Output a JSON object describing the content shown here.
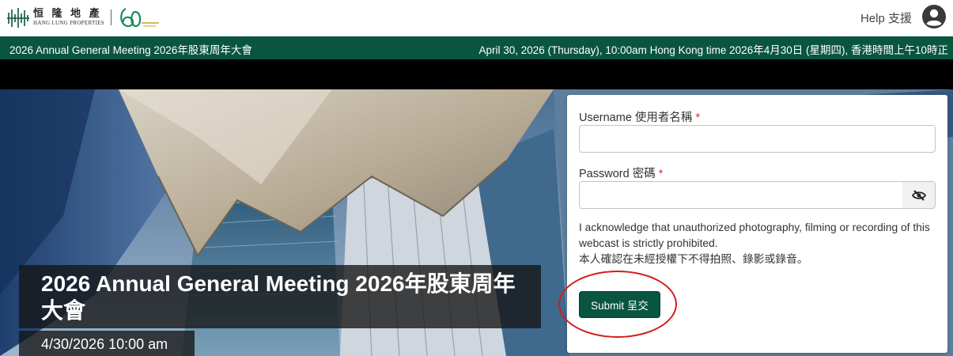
{
  "header": {
    "logo_cn": "恒 隆 地 產",
    "logo_en": "HANG LUNG PROPERTIES",
    "help_label": "Help 支援"
  },
  "banner": {
    "event_name": "2026 Annual General Meeting 2026年股東周年大會",
    "event_datetime": "April 30, 2026 (Thursday), 10:00am Hong Kong time 2026年4月30日 (星期四), 香港時間上午10時正"
  },
  "hero": {
    "title": "2026 Annual General Meeting 2026年股東周年大會",
    "date": "4/30/2026 10:00 am"
  },
  "login_form": {
    "username_label": "Username 使用者名稱",
    "username_value": "",
    "password_label": "Password 密碼",
    "password_value": "",
    "required_marker": "*",
    "acknowledgement": "I acknowledge that unauthorized photography, filming or recording of this webcast is strictly prohibited.",
    "acknowledgement_cn": "本人確認在未經授權下不得拍照、錄影或錄音。",
    "submit_label": "Submit 呈交"
  },
  "icons": {
    "user": "account-circle-icon",
    "password_toggle": "eye-off-icon"
  },
  "colors": {
    "brand_green": "#0a5540",
    "required": "#d9342b",
    "annotation": "#d51b1b"
  }
}
